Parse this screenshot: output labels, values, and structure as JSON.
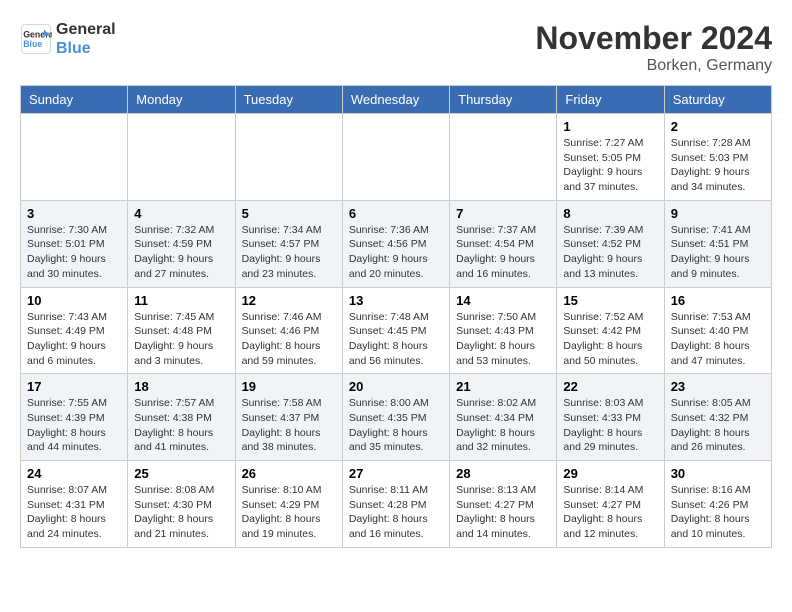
{
  "logo": {
    "line1": "General",
    "line2": "Blue"
  },
  "title": "November 2024",
  "location": "Borken, Germany",
  "days_of_week": [
    "Sunday",
    "Monday",
    "Tuesday",
    "Wednesday",
    "Thursday",
    "Friday",
    "Saturday"
  ],
  "weeks": [
    [
      {
        "day": "",
        "info": ""
      },
      {
        "day": "",
        "info": ""
      },
      {
        "day": "",
        "info": ""
      },
      {
        "day": "",
        "info": ""
      },
      {
        "day": "",
        "info": ""
      },
      {
        "day": "1",
        "info": "Sunrise: 7:27 AM\nSunset: 5:05 PM\nDaylight: 9 hours and 37 minutes."
      },
      {
        "day": "2",
        "info": "Sunrise: 7:28 AM\nSunset: 5:03 PM\nDaylight: 9 hours and 34 minutes."
      }
    ],
    [
      {
        "day": "3",
        "info": "Sunrise: 7:30 AM\nSunset: 5:01 PM\nDaylight: 9 hours and 30 minutes."
      },
      {
        "day": "4",
        "info": "Sunrise: 7:32 AM\nSunset: 4:59 PM\nDaylight: 9 hours and 27 minutes."
      },
      {
        "day": "5",
        "info": "Sunrise: 7:34 AM\nSunset: 4:57 PM\nDaylight: 9 hours and 23 minutes."
      },
      {
        "day": "6",
        "info": "Sunrise: 7:36 AM\nSunset: 4:56 PM\nDaylight: 9 hours and 20 minutes."
      },
      {
        "day": "7",
        "info": "Sunrise: 7:37 AM\nSunset: 4:54 PM\nDaylight: 9 hours and 16 minutes."
      },
      {
        "day": "8",
        "info": "Sunrise: 7:39 AM\nSunset: 4:52 PM\nDaylight: 9 hours and 13 minutes."
      },
      {
        "day": "9",
        "info": "Sunrise: 7:41 AM\nSunset: 4:51 PM\nDaylight: 9 hours and 9 minutes."
      }
    ],
    [
      {
        "day": "10",
        "info": "Sunrise: 7:43 AM\nSunset: 4:49 PM\nDaylight: 9 hours and 6 minutes."
      },
      {
        "day": "11",
        "info": "Sunrise: 7:45 AM\nSunset: 4:48 PM\nDaylight: 9 hours and 3 minutes."
      },
      {
        "day": "12",
        "info": "Sunrise: 7:46 AM\nSunset: 4:46 PM\nDaylight: 8 hours and 59 minutes."
      },
      {
        "day": "13",
        "info": "Sunrise: 7:48 AM\nSunset: 4:45 PM\nDaylight: 8 hours and 56 minutes."
      },
      {
        "day": "14",
        "info": "Sunrise: 7:50 AM\nSunset: 4:43 PM\nDaylight: 8 hours and 53 minutes."
      },
      {
        "day": "15",
        "info": "Sunrise: 7:52 AM\nSunset: 4:42 PM\nDaylight: 8 hours and 50 minutes."
      },
      {
        "day": "16",
        "info": "Sunrise: 7:53 AM\nSunset: 4:40 PM\nDaylight: 8 hours and 47 minutes."
      }
    ],
    [
      {
        "day": "17",
        "info": "Sunrise: 7:55 AM\nSunset: 4:39 PM\nDaylight: 8 hours and 44 minutes."
      },
      {
        "day": "18",
        "info": "Sunrise: 7:57 AM\nSunset: 4:38 PM\nDaylight: 8 hours and 41 minutes."
      },
      {
        "day": "19",
        "info": "Sunrise: 7:58 AM\nSunset: 4:37 PM\nDaylight: 8 hours and 38 minutes."
      },
      {
        "day": "20",
        "info": "Sunrise: 8:00 AM\nSunset: 4:35 PM\nDaylight: 8 hours and 35 minutes."
      },
      {
        "day": "21",
        "info": "Sunrise: 8:02 AM\nSunset: 4:34 PM\nDaylight: 8 hours and 32 minutes."
      },
      {
        "day": "22",
        "info": "Sunrise: 8:03 AM\nSunset: 4:33 PM\nDaylight: 8 hours and 29 minutes."
      },
      {
        "day": "23",
        "info": "Sunrise: 8:05 AM\nSunset: 4:32 PM\nDaylight: 8 hours and 26 minutes."
      }
    ],
    [
      {
        "day": "24",
        "info": "Sunrise: 8:07 AM\nSunset: 4:31 PM\nDaylight: 8 hours and 24 minutes."
      },
      {
        "day": "25",
        "info": "Sunrise: 8:08 AM\nSunset: 4:30 PM\nDaylight: 8 hours and 21 minutes."
      },
      {
        "day": "26",
        "info": "Sunrise: 8:10 AM\nSunset: 4:29 PM\nDaylight: 8 hours and 19 minutes."
      },
      {
        "day": "27",
        "info": "Sunrise: 8:11 AM\nSunset: 4:28 PM\nDaylight: 8 hours and 16 minutes."
      },
      {
        "day": "28",
        "info": "Sunrise: 8:13 AM\nSunset: 4:27 PM\nDaylight: 8 hours and 14 minutes."
      },
      {
        "day": "29",
        "info": "Sunrise: 8:14 AM\nSunset: 4:27 PM\nDaylight: 8 hours and 12 minutes."
      },
      {
        "day": "30",
        "info": "Sunrise: 8:16 AM\nSunset: 4:26 PM\nDaylight: 8 hours and 10 minutes."
      }
    ]
  ]
}
